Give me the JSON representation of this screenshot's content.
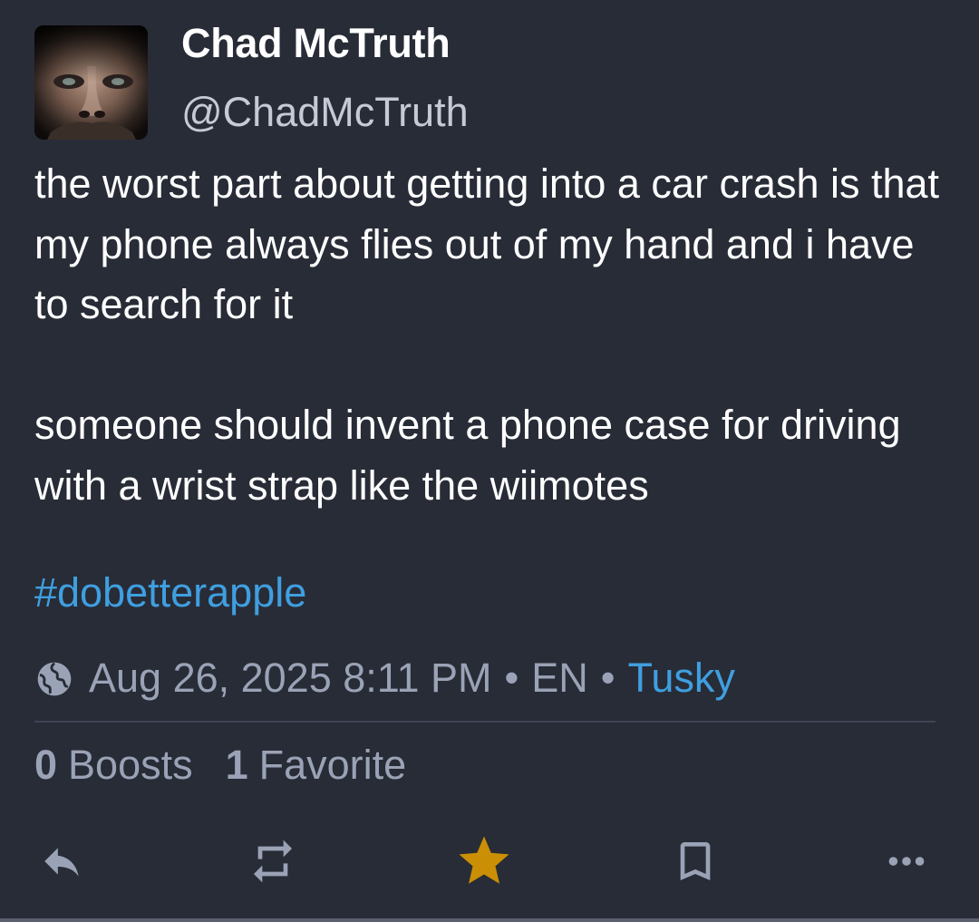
{
  "author": {
    "display_name": "Chad McTruth",
    "username": "@ChadMcTruth"
  },
  "post": {
    "paragraphs": [
      "the worst part about getting into a car crash is that my phone always flies out of my hand and i have to search for it",
      "someone should invent a phone case for driving with a wrist strap like the wiimotes"
    ],
    "hashtag": "#dobetterapple"
  },
  "meta": {
    "visibility_icon": "globe-icon",
    "timestamp": "Aug 26, 2025 8:11 PM",
    "separator": "•",
    "language": "EN",
    "application": "Tusky"
  },
  "stats": {
    "boosts_count": "0",
    "boosts_label": "Boosts",
    "favorites_count": "1",
    "favorites_label": "Favorite"
  },
  "actions": [
    {
      "icon": "reply-icon",
      "active": false
    },
    {
      "icon": "boost-icon",
      "active": false
    },
    {
      "icon": "star-icon",
      "active": true
    },
    {
      "icon": "bookmark-icon",
      "active": false
    },
    {
      "icon": "more-icon",
      "active": false
    }
  ],
  "colors": {
    "background": "#282c37",
    "link": "#3f9fe0",
    "muted": "#9aa3b6",
    "favorite_active": "#ca8f04"
  }
}
